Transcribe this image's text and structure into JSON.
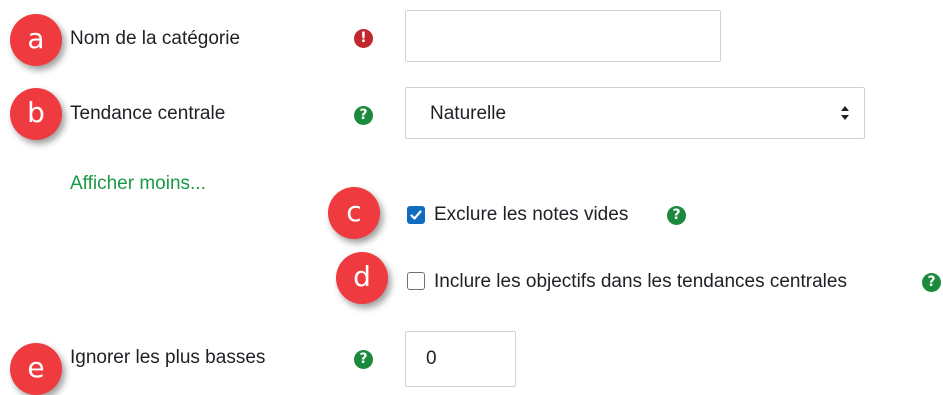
{
  "badges": [
    "a",
    "b",
    "c",
    "d",
    "e"
  ],
  "fields": {
    "category_name": {
      "label": "Nom de la catégorie",
      "value": "",
      "required_icon": "exclamation-icon"
    },
    "aggregation": {
      "label": "Tendance centrale",
      "selected": "Naturelle",
      "help_icon": "question-icon"
    },
    "show_less_link": "Afficher moins...",
    "exclude_empty": {
      "label": "Exclure les notes vides",
      "checked": true,
      "help_icon": "question-icon"
    },
    "include_outcomes": {
      "label": "Inclure les objectifs dans les tendances centrales",
      "checked": false,
      "help_icon": "question-icon"
    },
    "drop_lowest": {
      "label": "Ignorer les plus basses",
      "value": "0",
      "help_icon": "question-icon"
    }
  },
  "icons": {
    "help": "?",
    "required": "!"
  },
  "colors": {
    "badge": "#ef3a3f",
    "help_icon": "#1a8a3c",
    "required_icon": "#c0282d",
    "link": "#1a9a46",
    "checkbox_checked": "#0f6cbf"
  }
}
